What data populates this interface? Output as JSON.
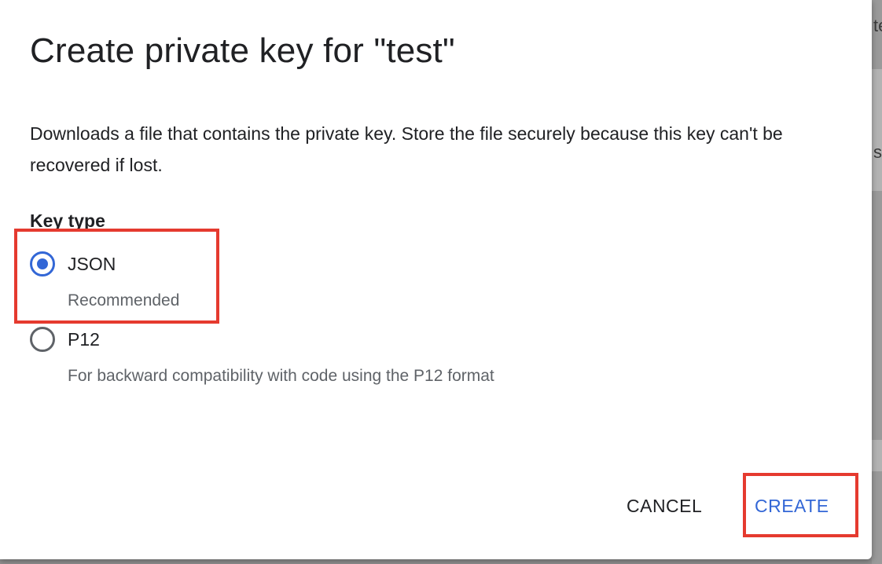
{
  "background": {
    "glyphs": [
      "te",
      "s"
    ]
  },
  "dialog": {
    "title": "Create private key for \"test\"",
    "description": "Downloads a file that contains the private key. Store the file securely because this key can't be recovered if lost.",
    "key_type_label": "Key type",
    "options": [
      {
        "label": "JSON",
        "sublabel": "Recommended",
        "selected": true
      },
      {
        "label": "P12",
        "sublabel": "For backward compatibility with code using the P12 format",
        "selected": false
      }
    ],
    "actions": {
      "cancel_label": "CANCEL",
      "create_label": "CREATE"
    }
  },
  "colors": {
    "accent": "#3367d6",
    "highlight": "#e53a2f",
    "text_primary": "#202124",
    "text_secondary": "#5f6368",
    "backdrop": "#8f8f8f"
  },
  "annotations": {
    "highlighted_items": [
      "json-option",
      "create-button"
    ]
  }
}
